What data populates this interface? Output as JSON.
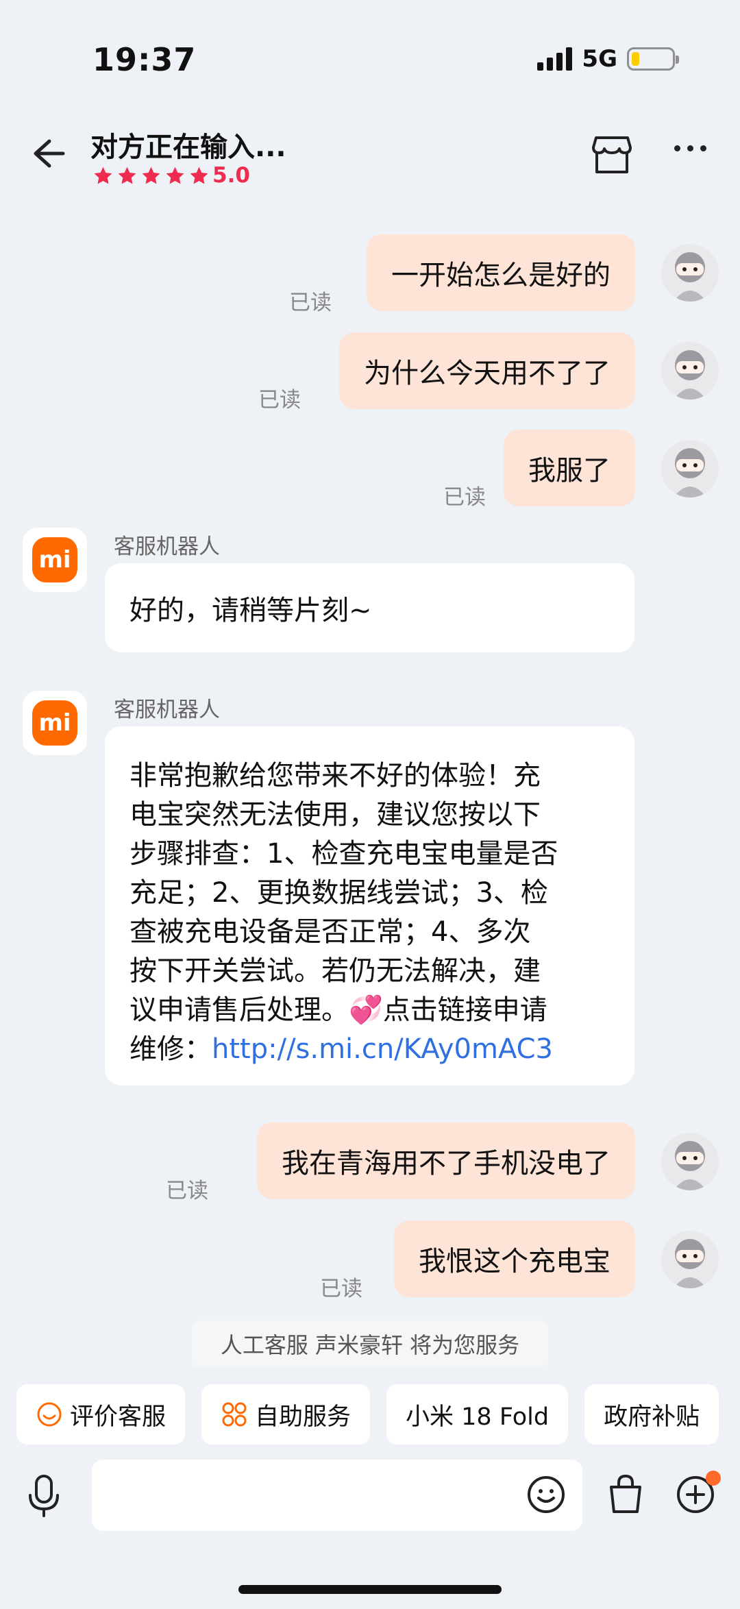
{
  "status_bar": {
    "time": "19:37",
    "network": "5G"
  },
  "header": {
    "title": "对方正在输入...",
    "rating": "5.0"
  },
  "messages": {
    "m1": {
      "text": "一开始怎么是好的",
      "read": "已读"
    },
    "m2": {
      "text": "为什么今天用不了了",
      "read": "已读"
    },
    "m3": {
      "text": "我服了",
      "read": "已读"
    },
    "b1": {
      "sender": "客服机器人",
      "text": "好的，请稍等片刻~"
    },
    "b2": {
      "sender": "客服机器人",
      "lines": [
        "非常抱歉给您带来不好的体验！充",
        "电宝突然无法使用，建议您按以下",
        "步骤排查：1、检查充电宝电量是否",
        "充足；2、更换数据线尝试；3、检",
        "查被充电设备是否正常；4、多次",
        "按下开关尝试。若仍无法解决，建",
        "议申请售后处理。💞点击链接申请"
      ],
      "last_prefix": "维修：",
      "link": "http://s.mi.cn/KAy0mAC3"
    },
    "m4": {
      "text": "我在青海用不了手机没电了",
      "read": "已读"
    },
    "m5": {
      "text": "我恨这个充电宝",
      "read": "已读"
    }
  },
  "service_note": "人工客服 声米豪轩 将为您服务",
  "chips": [
    "评价客服",
    "自助服务",
    "小米 18 Fold",
    "政府补贴"
  ],
  "colors": {
    "accent": "#ff6900",
    "star": "#ef2c4f",
    "outgoing": "#fde4d7",
    "link": "#2f6fe0"
  }
}
